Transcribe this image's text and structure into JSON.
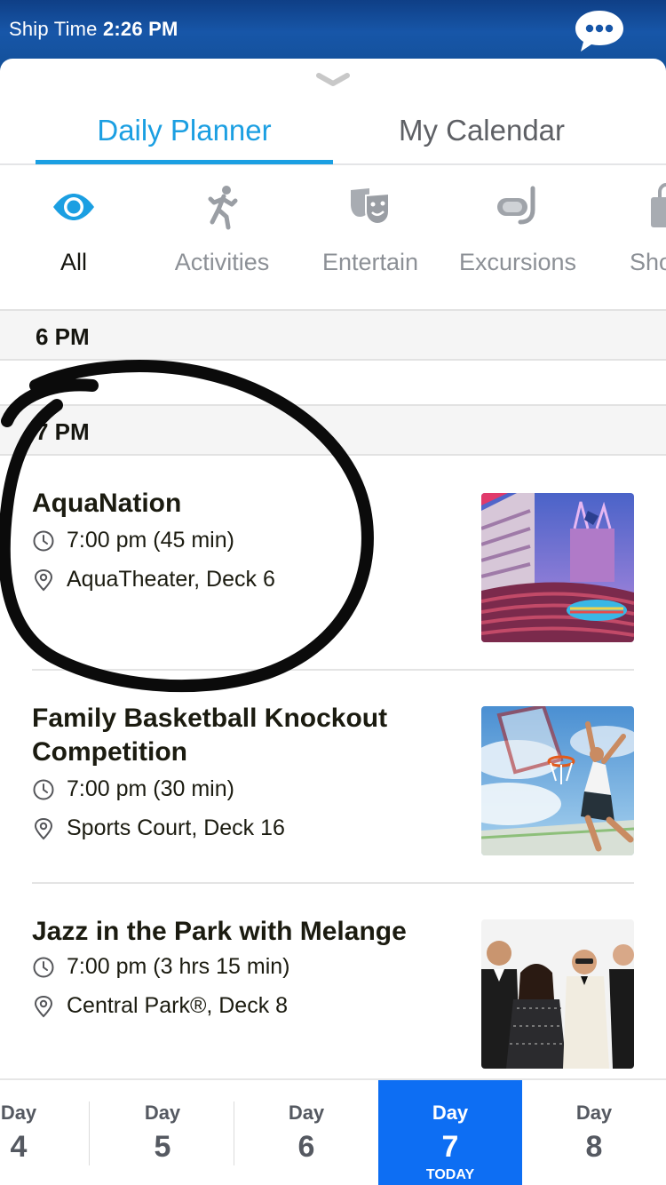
{
  "status": {
    "label": "Ship Time",
    "time": "2:26 PM"
  },
  "tabs": [
    {
      "label": "Daily Planner",
      "active": true
    },
    {
      "label": "My Calendar",
      "active": false
    }
  ],
  "filters": [
    {
      "label": "All",
      "icon": "eye-icon",
      "active": true
    },
    {
      "label": "Activities",
      "icon": "running-person-icon",
      "active": false
    },
    {
      "label": "Entertain",
      "icon": "theater-masks-icon",
      "active": false
    },
    {
      "label": "Excursions",
      "icon": "snorkel-mask-icon",
      "active": false
    },
    {
      "label": "Sho",
      "icon": "shopping-bag-icon",
      "active": false
    }
  ],
  "timeHeaders": [
    "6 PM",
    "7 PM"
  ],
  "events": [
    {
      "title": "AquaNation",
      "time": "7:00 pm (45 min)",
      "location": "AquaTheater, Deck 6",
      "image": "aquatheater-photo"
    },
    {
      "title": "Family Basketball Knockout Competition",
      "time": "7:00 pm (30 min)",
      "location": "Sports Court, Deck 16",
      "image": "basketball-photo"
    },
    {
      "title": "Jazz in the Park with Melange",
      "time": "7:00 pm (3 hrs 15 min)",
      "location": "Central Park®, Deck 8",
      "image": "jazz-band-photo"
    }
  ],
  "days": [
    {
      "word": "Day",
      "num": "4"
    },
    {
      "word": "Day",
      "num": "5"
    },
    {
      "word": "Day",
      "num": "6"
    },
    {
      "word": "Day",
      "num": "7",
      "today": "TODAY",
      "active": true
    },
    {
      "word": "Day",
      "num": "8"
    }
  ],
  "colors": {
    "accent": "#1b9fe2",
    "dayActive": "#0d6ef3",
    "header": "#1756a8"
  }
}
